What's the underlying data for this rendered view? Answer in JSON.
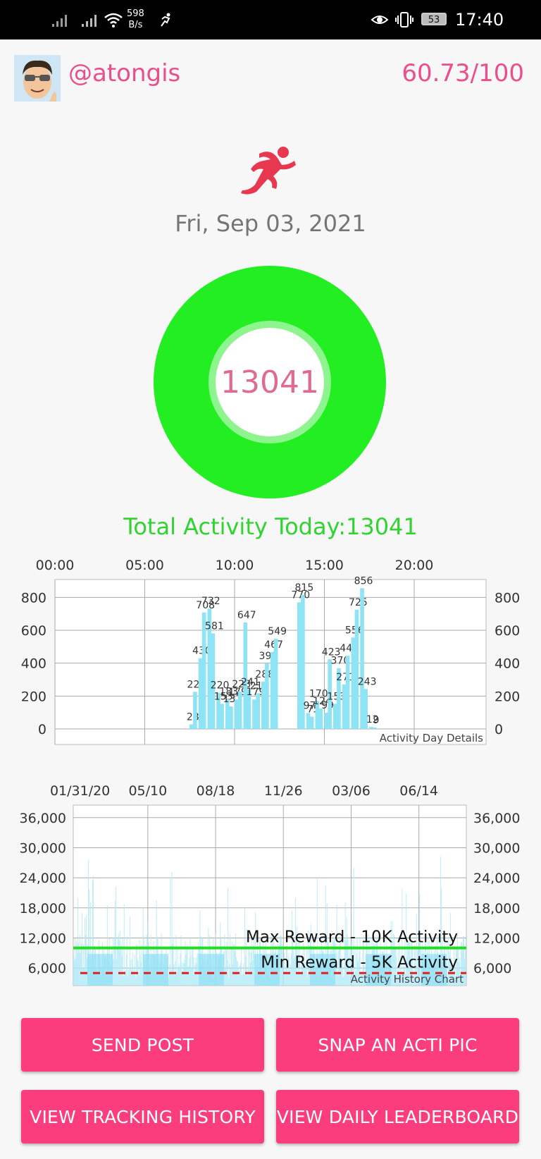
{
  "status_bar": {
    "net_speed_value": "598",
    "net_speed_unit": "B/s",
    "battery": "53",
    "time": "17:40",
    "icons": [
      "signal-icon",
      "signal-icon",
      "wifi-icon",
      "running-notification-icon",
      "eye-icon",
      "vibrate-icon",
      "battery-icon"
    ]
  },
  "profile": {
    "username": "@atongis",
    "score": "60.73/100",
    "avatar_icon": "avatar-icon"
  },
  "runner_icon": "runner-icon",
  "date": "Fri, Sep 03, 2021",
  "activity_ring": {
    "value": "13041",
    "progress": 1.0,
    "ring_color": "#22ee22"
  },
  "total_activity": "Total Activity Today:13041",
  "day_chart": {
    "title": "Activity Day Details",
    "x_tick_labels": [
      "00:00",
      "05:00",
      "10:00",
      "15:00",
      "20:00"
    ],
    "y_tick_labels": [
      "0",
      "200",
      "400",
      "600",
      "800"
    ],
    "color": "#8ee4f5"
  },
  "history_chart": {
    "title": "Activity History Chart",
    "x_tick_labels": [
      "01/31/20",
      "05/10",
      "08/18",
      "11/26",
      "03/06",
      "06/14"
    ],
    "y_tick_labels": [
      "6,000",
      "12,000",
      "18,000",
      "24,000",
      "30,000",
      "36,000"
    ],
    "max_line_label": "Max Reward - 10K Activity",
    "min_line_label": "Min Reward - 5K Activity",
    "max_line_color": "#22dd22",
    "min_line_color": "#dd2222"
  },
  "chart_data": [
    {
      "type": "bar",
      "title": "Activity Day Details",
      "xlabel": "",
      "ylabel": "",
      "x_unit": "hour of day",
      "xlim": [
        0,
        24
      ],
      "ylim": [
        0,
        900
      ],
      "x": [
        7.6,
        7.8,
        8.1,
        8.3,
        8.6,
        8.8,
        9.1,
        9.3,
        9.6,
        9.8,
        10.1,
        10.3,
        10.6,
        10.8,
        11.1,
        11.3,
        11.6,
        11.8,
        12.1,
        12.3,
        12.6,
        12.8,
        13.6,
        13.8,
        14.1,
        14.3,
        14.6,
        14.8,
        15.1,
        15.3,
        15.6,
        15.8,
        16.1,
        16.3,
        16.6,
        16.8,
        17.1,
        17.3,
        17.6,
        17.8
      ],
      "values": [
        28,
        226,
        430,
        708,
        732,
        581,
        220,
        153,
        183,
        137,
        179,
        228,
        647,
        241,
        179,
        217,
        288,
        398,
        467,
        549,
        0,
        0,
        770,
        815,
        97,
        75,
        170,
        124,
        99,
        423,
        153,
        370,
        271,
        446,
        556,
        725,
        856,
        243,
        12,
        9
      ],
      "data_labels": [
        "28",
        "226",
        "430",
        "708",
        "732",
        "581",
        "220",
        "153",
        "183",
        "137",
        "179",
        "228",
        "647",
        "241",
        "179",
        "217",
        "288",
        "398",
        "467",
        "549",
        "",
        "",
        "770",
        "815",
        "97",
        "75",
        "170",
        "124",
        "99",
        "423",
        "153",
        "370",
        "271",
        "446",
        "556",
        "725",
        "856",
        "243",
        "12",
        "9"
      ]
    },
    {
      "type": "bar",
      "title": "Activity History Chart",
      "xlabel": "",
      "ylabel": "",
      "x_tick_labels": [
        "01/31/20",
        "05/10",
        "08/18",
        "11/26",
        "03/06",
        "06/14"
      ],
      "ylim": [
        2500,
        38500
      ],
      "reference_lines": [
        {
          "label": "Max Reward - 10K Activity",
          "y": 10000,
          "style": "solid"
        },
        {
          "label": "Min Reward - 5K Activity",
          "y": 5000,
          "style": "dashed"
        }
      ],
      "note": "Daily activity series from 01/31/20 onward, roughly 0 to 35,000 per day"
    }
  ],
  "buttons": {
    "send_post": "SEND POST",
    "snap_pic": "SNAP AN ACTI PIC",
    "view_history": "VIEW TRACKING HISTORY",
    "view_leaderboard": "VIEW DAILY LEADERBOARD"
  }
}
